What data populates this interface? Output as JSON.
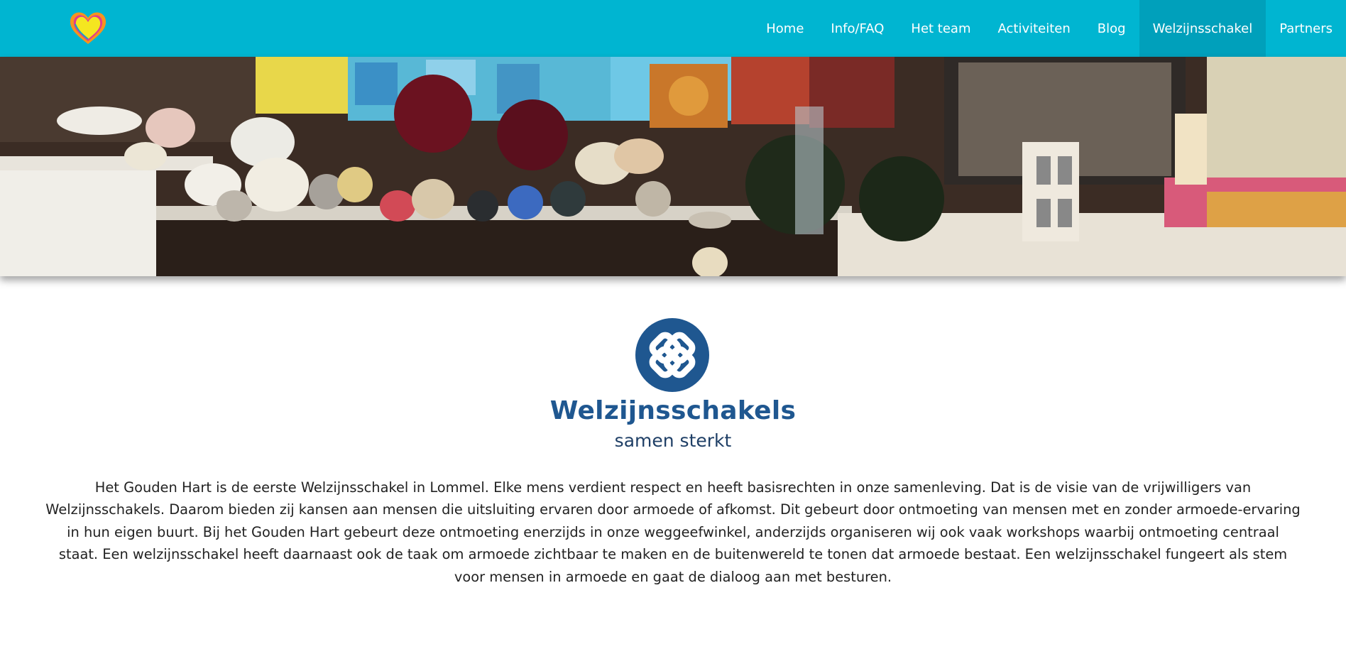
{
  "header": {
    "logo_icon": "heart-logo-icon",
    "nav": [
      {
        "label": "Home",
        "active": false
      },
      {
        "label": "Info/FAQ",
        "active": false
      },
      {
        "label": "Het team",
        "active": false
      },
      {
        "label": "Activiteiten",
        "active": false
      },
      {
        "label": "Blog",
        "active": false
      },
      {
        "label": "Welzijnsschakel",
        "active": true
      },
      {
        "label": "Partners",
        "active": false
      }
    ]
  },
  "hero": {
    "image": "weggeefwinkel-shelves-photo"
  },
  "brand": {
    "icon": "knot-link-icon",
    "name": "Welzijnsschakels",
    "tagline": "samen sterkt"
  },
  "main": {
    "intro": "Het Gouden Hart is de eerste Welzijnsschakel in Lommel. Elke mens verdient respect en heeft basisrechten in onze samenleving. Dat is de visie van de vrijwilligers van Welzijnsschakels. Daarom bieden zij kansen aan mensen die uitsluiting ervaren door armoede of afkomst. Dit gebeurt door ontmoeting van mensen met en zonder armoede-ervaring in hun eigen buurt. Bij het Gouden Hart gebeurt deze ontmoeting enerzijds in onze weggeefwinkel, anderzijds organiseren wij ook vaak workshops waarbij ontmoeting centraal staat. Een welzijnsschakel heeft daarnaast ook de taak om armoede zichtbaar te maken en de buitenwereld te tonen dat armoede bestaat. Een welzijnsschakel fungeert als stem voor mensen in armoede en gaat de dialoog aan met besturen."
  },
  "colors": {
    "nav_bg": "#00b5d1",
    "nav_active_bg": "#00a0bb",
    "brand_blue": "#1f5790"
  }
}
